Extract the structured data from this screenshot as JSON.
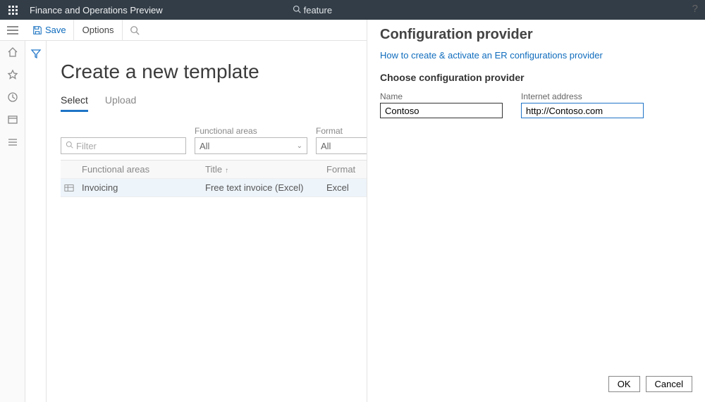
{
  "topbar": {
    "app_title": "Finance and Operations Preview",
    "search_text": "feature"
  },
  "actionbar": {
    "save_label": "Save",
    "options_label": "Options"
  },
  "page": {
    "title": "Create a new template",
    "tabs": [
      {
        "label": "Select",
        "active": true
      },
      {
        "label": "Upload",
        "active": false
      }
    ]
  },
  "filters": {
    "filter_placeholder": "Filter",
    "functional_areas_label": "Functional areas",
    "functional_areas_value": "All",
    "format_label": "Format",
    "format_value": "All"
  },
  "grid": {
    "headers": {
      "functional_areas": "Functional areas",
      "title": "Title",
      "format": "Format"
    },
    "rows": [
      {
        "functional_areas": "Invoicing",
        "title": "Free text invoice (Excel)",
        "format": "Excel"
      }
    ]
  },
  "panel": {
    "title": "Configuration provider",
    "link": "How to create & activate an ER configurations provider",
    "subtitle": "Choose configuration provider",
    "name_label": "Name",
    "name_value": "Contoso",
    "internet_label": "Internet address",
    "internet_value": "http://Contoso.com",
    "ok_label": "OK",
    "cancel_label": "Cancel"
  }
}
